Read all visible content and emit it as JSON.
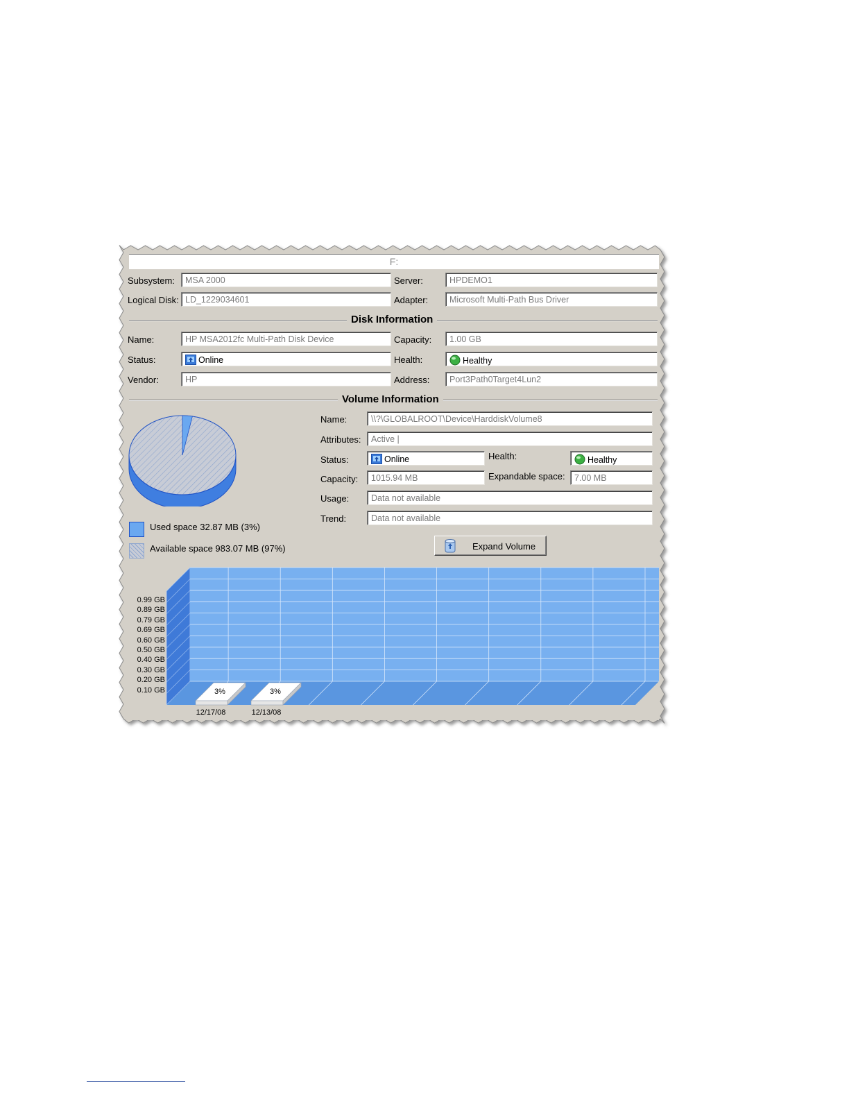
{
  "window": {
    "title": "F:"
  },
  "header": {
    "subsystem_label": "Subsystem:",
    "subsystem_value": "MSA 2000",
    "server_label": "Server:",
    "server_value": "HPDEMO1",
    "logical_disk_label": "Logical Disk:",
    "logical_disk_value": "LD_1229034601",
    "adapter_label": "Adapter:",
    "adapter_value": "Microsoft Multi-Path Bus Driver"
  },
  "disk_info": {
    "section_title": "Disk Information",
    "name_label": "Name:",
    "name_value": "HP MSA2012fc  Multi-Path Disk Device",
    "capacity_label": "Capacity:",
    "capacity_value": "1.00 GB",
    "status_label": "Status:",
    "status_value": "Online",
    "health_label": "Health:",
    "health_value": "Healthy",
    "vendor_label": "Vendor:",
    "vendor_value": "HP",
    "address_label": "Address:",
    "address_value": "Port3Path0Target4Lun2"
  },
  "volume_info": {
    "section_title": "Volume Information",
    "name_label": "Name:",
    "name_value": "\\\\?\\GLOBALROOT\\Device\\HarddiskVolume8",
    "attributes_label": "Attributes:",
    "attributes_value": "Active |",
    "status_label": "Status:",
    "status_value": "Online",
    "health_label": "Health:",
    "health_value": "Healthy",
    "capacity_label": "Capacity:",
    "capacity_value": "1015.94 MB",
    "expandable_label": "Expandable space:",
    "expandable_value": "7.00 MB",
    "usage_label": "Usage:",
    "usage_value": "Data not available",
    "trend_label": "Trend:",
    "trend_value": "Data not available",
    "expand_button": "Expand Volume"
  },
  "pie_legend": {
    "used": "Used space 32.87 MB (3%)",
    "available": "Available space 983.07 MB (97%)"
  },
  "colors": {
    "accent": "#5b9be6",
    "used_slice": "#6aa8f0",
    "bar_white": "#ffffff",
    "health_green": "#3cb043",
    "panel_bg": "#d4d0c8"
  },
  "chart_data": [
    {
      "type": "pie",
      "slices": [
        {
          "label": "Used space 32.87 MB (3%)",
          "value": 3
        },
        {
          "label": "Available space 983.07 MB (97%)",
          "value": 97
        }
      ]
    },
    {
      "type": "bar",
      "categories": [
        "12/17/08",
        "12/13/08"
      ],
      "values": [
        0.03,
        0.03
      ],
      "data_labels": [
        "3%",
        "3%"
      ],
      "yticks": [
        "0.99 GB",
        "0.89 GB",
        "0.79 GB",
        "0.69 GB",
        "0.60 GB",
        "0.50 GB",
        "0.40 GB",
        "0.30 GB",
        "0.20 GB",
        "0.10 GB"
      ],
      "ylim": [
        0,
        1.09
      ],
      "grid": true
    }
  ]
}
